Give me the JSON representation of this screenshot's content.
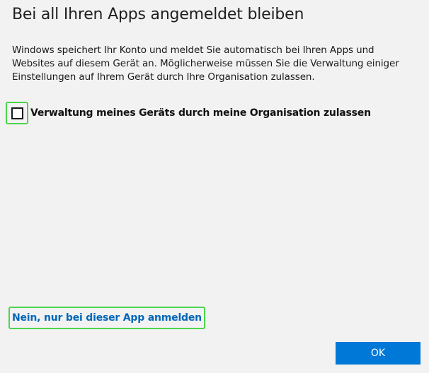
{
  "dialog": {
    "title": "Bei all Ihren Apps angemeldet bleiben",
    "description": "Windows speichert Ihr Konto und meldet Sie automatisch bei Ihren Apps und Websites auf diesem Gerät an. Möglicherweise müssen Sie die Verwaltung einiger Einstellungen auf Ihrem Gerät durch Ihre Organisation zulassen.",
    "checkbox": {
      "label": "Verwaltung meines Geräts durch meine Organisation zulassen",
      "checked": false
    },
    "app_only_link": "Nein, nur bei dieser App anmelden",
    "ok_label": "OK"
  },
  "colors": {
    "background": "#f2f2f2",
    "accent": "#0078d7",
    "link": "#0067b8",
    "focus_outline": "#4cd44c"
  }
}
